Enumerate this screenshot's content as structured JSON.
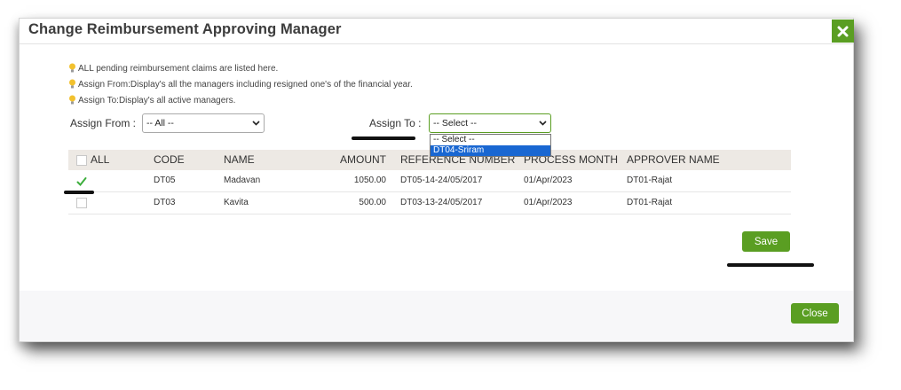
{
  "modal": {
    "title": "Change Reimbursement Approving Manager",
    "close_icon": "close-x-icon"
  },
  "notes": [
    "ALL pending reimbursement claims are listed here.",
    "Assign From:Display's all the managers including resigned one's of the financial year.",
    "Assign To:Display's all active managers."
  ],
  "assign_from": {
    "label": "Assign From :",
    "selected": "-- All --"
  },
  "assign_to": {
    "label": "Assign To :",
    "selected": "-- Select --",
    "options": [
      "-- Select --",
      "DT04-Sriram"
    ],
    "highlighted": "DT04-Sriram"
  },
  "table": {
    "headers": {
      "all": "ALL",
      "code": "CODE",
      "name": "NAME",
      "amount": "AMOUNT",
      "reference": "REFERENCE NUMBER",
      "process_month": "PROCESS MONTH",
      "approver": "APPROVER NAME"
    },
    "rows": [
      {
        "checked": true,
        "code": "DT05",
        "name": "Madavan",
        "amount": "1050.00",
        "reference": "DT05-14-24/05/2017",
        "process_month": "01/Apr/2023",
        "approver": "DT01-Rajat"
      },
      {
        "checked": false,
        "code": "DT03",
        "name": "Kavita",
        "amount": "500.00",
        "reference": "DT03-13-24/05/2017",
        "process_month": "01/Apr/2023",
        "approver": "DT01-Rajat"
      }
    ]
  },
  "buttons": {
    "save": "Save",
    "close": "Close"
  },
  "colors": {
    "accent": "#5a9e22",
    "header_bg": "#ede9e4",
    "highlight": "#1967d2"
  }
}
